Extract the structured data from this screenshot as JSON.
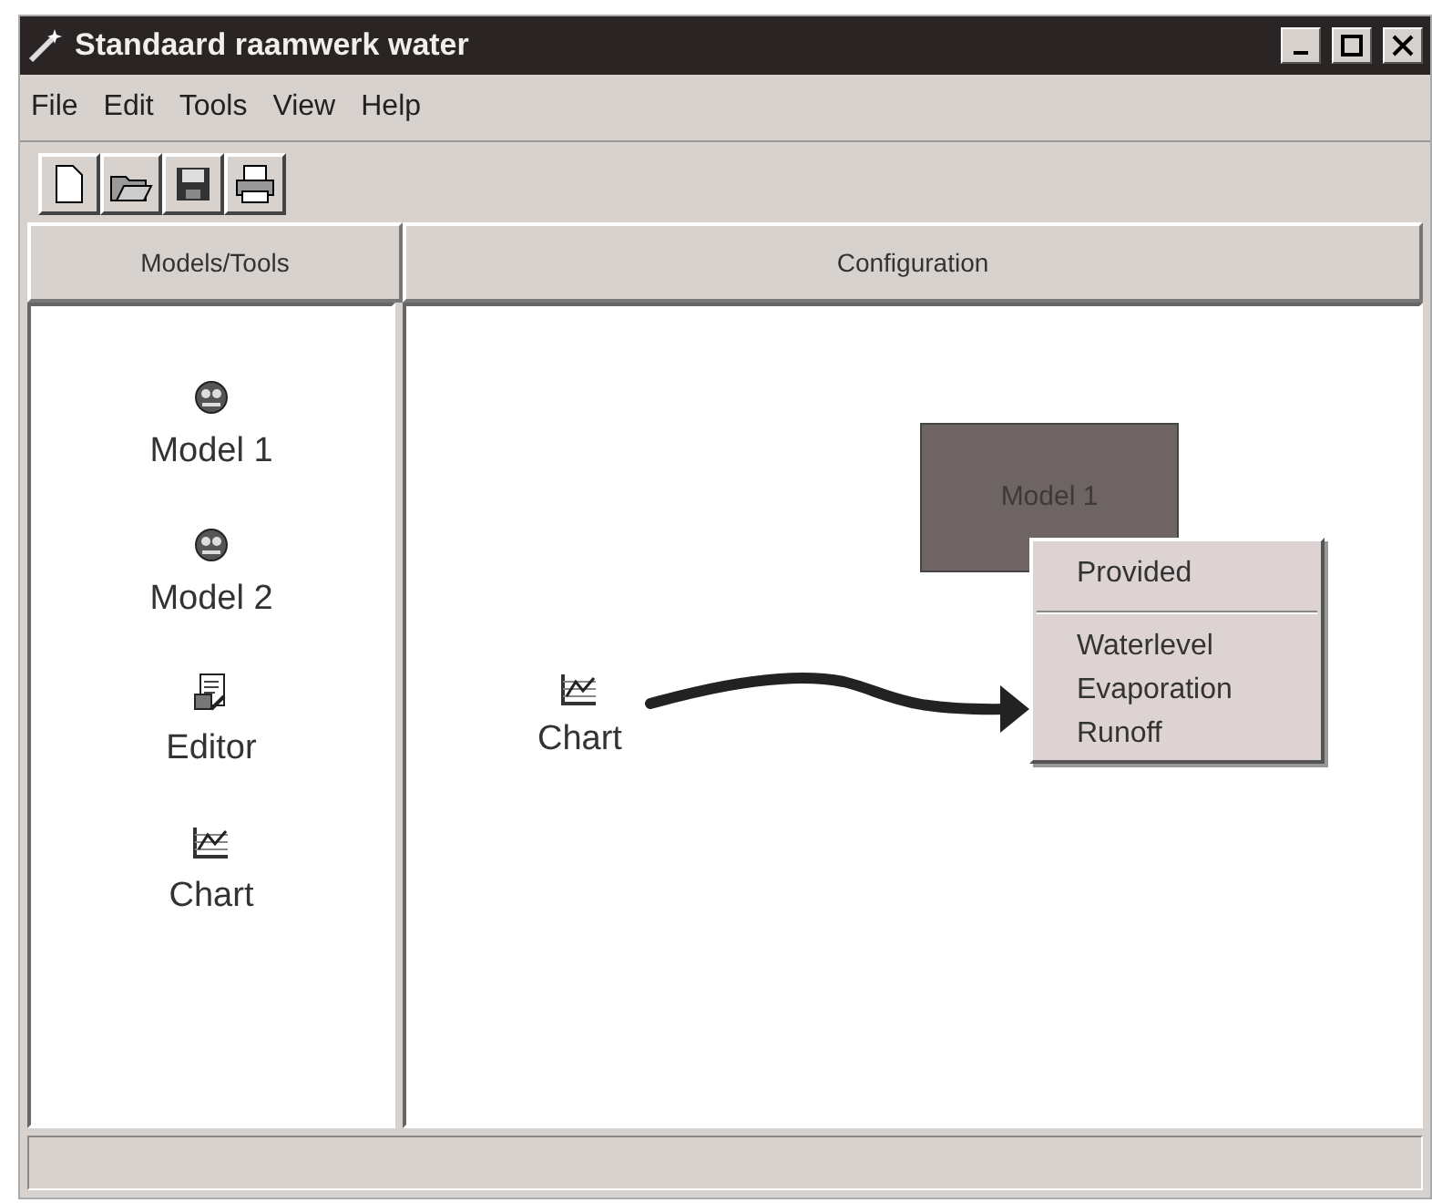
{
  "window": {
    "title": "Standaard raamwerk water"
  },
  "menu": [
    "File",
    "Edit",
    "Tools",
    "View",
    "Help"
  ],
  "panels": [
    {
      "heading": "Models/Tools"
    },
    {
      "heading": "Configuration"
    }
  ],
  "palette": [
    {
      "label": "Model 1",
      "kind": "model"
    },
    {
      "label": "Model 2",
      "kind": "model"
    },
    {
      "label": "Editor",
      "kind": "editor"
    },
    {
      "label": "Chart",
      "kind": "chart"
    }
  ],
  "canvas": {
    "model_node": {
      "label": "Model 1"
    },
    "chart_node": {
      "label": "Chart"
    },
    "context_menu": [
      {
        "label": "Provided",
        "kind": "header"
      },
      {
        "label": "Waterlevel",
        "kind": "item"
      },
      {
        "label": "Evaporation",
        "kind": "item"
      },
      {
        "label": "Runoff",
        "kind": "item"
      }
    ]
  }
}
